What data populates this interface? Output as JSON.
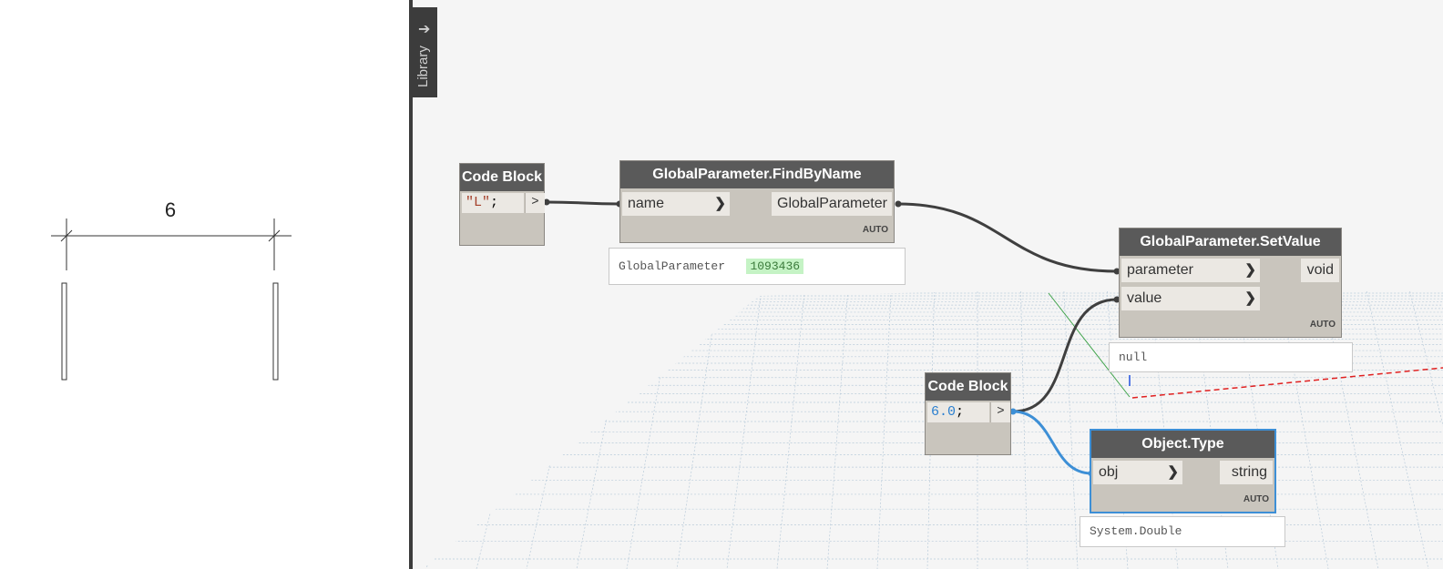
{
  "revit_view": {
    "dimension_value": "6"
  },
  "library": {
    "label": "Library",
    "arrow": "➔"
  },
  "nodes": {
    "code_block_1": {
      "title": "Code Block",
      "code_string": "\"L\"",
      "code_suffix": ";",
      "output_port": ">"
    },
    "find_by_name": {
      "title": "GlobalParameter.FindByName",
      "input_port": "name",
      "output_port": "GlobalParameter",
      "lacing": "AUTO",
      "preview_type": "GlobalParameter",
      "preview_value": "1093436"
    },
    "set_value": {
      "title": "GlobalParameter.SetValue",
      "input_port_1": "parameter",
      "input_port_2": "value",
      "output_port": "void",
      "lacing": "AUTO",
      "preview_value": "null"
    },
    "code_block_2": {
      "title": "Code Block",
      "code_number": "6.0",
      "code_suffix": ";",
      "output_port": ">"
    },
    "object_type": {
      "title": "Object.Type",
      "input_port": "obj",
      "output_port": "string",
      "lacing": "AUTO",
      "preview_value": "System.Double"
    }
  },
  "colors": {
    "node_header": "#5a5a5a",
    "node_body": "#c9c5bd",
    "wire": "#3f3f3f",
    "selected_wire": "#3d8fd6",
    "preview_highlight": "#c5f3c5"
  },
  "icons": {
    "port_arrow": "chevron-right-icon",
    "library_arrow": "arrow-right-icon"
  }
}
